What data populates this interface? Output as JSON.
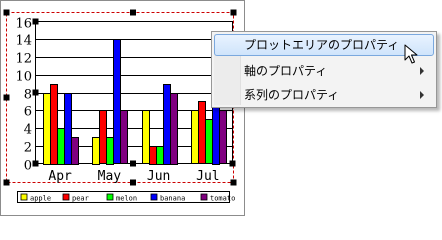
{
  "chart_data": {
    "type": "bar",
    "categories": [
      "Apr",
      "May",
      "Jun",
      "Jul"
    ],
    "yticks": [
      "0",
      "2",
      "4",
      "6",
      "8",
      "10",
      "12",
      "14",
      "16"
    ],
    "ylim": [
      0,
      16
    ],
    "series": [
      {
        "name": "apple",
        "color": "#ffff00",
        "values": [
          8,
          3,
          6,
          6
        ]
      },
      {
        "name": "pear",
        "color": "#ff0000",
        "values": [
          9,
          6,
          2,
          7
        ]
      },
      {
        "name": "melon",
        "color": "#00ff00",
        "values": [
          4,
          3,
          2,
          5
        ]
      },
      {
        "name": "banana",
        "color": "#0000ff",
        "values": [
          8,
          14,
          9,
          12
        ]
      },
      {
        "name": "tomato",
        "color": "#800080",
        "values": [
          3,
          6,
          8,
          6
        ]
      }
    ],
    "grid": true,
    "legend_placement": "bottom"
  },
  "context_menu": {
    "items": [
      {
        "label": "プロットエリアのプロパティ",
        "highlighted": true,
        "submenu": false
      },
      {
        "label": "軸のプロパティ",
        "highlighted": false,
        "submenu": true
      },
      {
        "label": "系列のプロパティ",
        "highlighted": false,
        "submenu": true
      }
    ]
  },
  "colors": {
    "selection": "#cc0000",
    "menu_highlight": "#cfe4fb"
  }
}
